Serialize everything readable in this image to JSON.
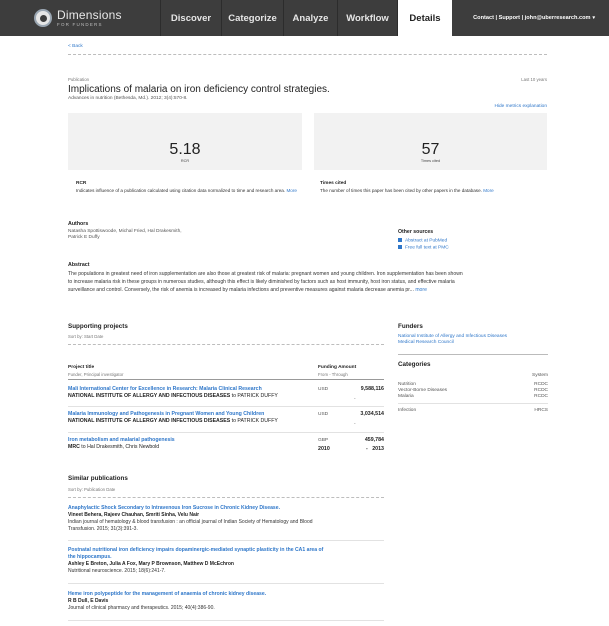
{
  "header": {
    "logo_title": "Dimensions",
    "logo_sub": "FOR FUNDERS",
    "nav": [
      "Discover",
      "Categorize",
      "Analyze",
      "Workflow",
      "Details"
    ],
    "right": "Contact | Support | john@uberresearch.com"
  },
  "back_label": "< Back",
  "publication": {
    "type_label": "Publication",
    "time_range": "Last 10 years",
    "title": "Implications of malaria on iron deficiency control strategies.",
    "citation": "Advances in nutrition (Bethesda, Md.). 2012; 3(4):570-8.",
    "hide_metrics": "Hide metrics explanation"
  },
  "metrics": {
    "rcr_value": "5.18",
    "rcr_label": "RCR",
    "rcr_title": "RCR",
    "rcr_desc": "Indicates influence of a publication calculated using citation data normalized to time and research area.",
    "rcr_more": "More",
    "cited_value": "57",
    "cited_label": "Times cited",
    "cited_title": "Times cited",
    "cited_desc": "The number of times this paper has been cited by other papers in the database.",
    "cited_more": "More"
  },
  "authors": {
    "heading": "Authors",
    "line1": "Natasha Spottiswoode, Michal Fried, Hal Drakesmith,",
    "line2": "Patrick E Duffy"
  },
  "other_sources": {
    "heading": "Other sources",
    "items": [
      "Abstract at PubMed",
      "Free full text at PMC"
    ]
  },
  "abstract": {
    "heading": "Abstract",
    "line1": "The populations in greatest need of iron supplementation are also those at greatest risk of malaria: pregnant women and young children. Iron supplementation has been shown",
    "line2": "to increase malaria risk in these groups in numerous studies, although this effect is likely diminished by factors such as host immunity, host iron status, and effective malaria",
    "line3": "surveillance and control. Conversely, the risk of anemia is increased by malaria infections and preventive measures against malaria decrease anemia pr...",
    "more": "more"
  },
  "supporting_projects": {
    "heading": "Supporting projects",
    "sort": "Sort by: Start Date",
    "col_title": "Project title",
    "col_title_sub": "Funder, Principal investigator",
    "col_funding": "Funding Amount",
    "col_funding_sub": "From - Through",
    "projects": [
      {
        "title": "Mali International Center for Excellence in Research: Malaria Clinical Research",
        "funder": "NATIONAL INSTITUTE OF ALLERGY AND INFECTIOUS DISEASES",
        "to": "to",
        "pi": "PATRICK DUFFY",
        "currency": "USD",
        "amount": "9,588,116",
        "from": "",
        "through": "-"
      },
      {
        "title": "Malaria Immunology and Pathogenesis in Pregnant Women and Young Children",
        "funder": "NATIONAL INSTITUTE OF ALLERGY AND INFECTIOUS DISEASES",
        "to": "to",
        "pi": "PATRICK DUFFY",
        "currency": "USD",
        "amount": "3,034,514",
        "from": "",
        "through": "-"
      },
      {
        "title": "Iron metabolism and malarial pathogenesis",
        "funder": "MRC",
        "to": "to",
        "pi": "Hal Drakesmith, Chris Newbold",
        "currency": "GBP",
        "amount": "459,784",
        "from": "2010",
        "through": "-   2013"
      }
    ]
  },
  "funders": {
    "heading": "Funders",
    "items": [
      "National Institute of Allergy and Infectious Diseases",
      "Medical Research Council"
    ]
  },
  "categories": {
    "heading": "Categories",
    "system_label": "System",
    "groups": [
      {
        "names": [
          "Nutrition",
          "Vector-Borne Diseases",
          "Malaria"
        ],
        "systems": [
          "RCDC",
          "RCDC",
          "RCDC"
        ]
      },
      {
        "names": [
          "Infection"
        ],
        "systems": [
          "HRCS"
        ]
      }
    ]
  },
  "similar": {
    "heading": "Similar publications",
    "sort": "Sort by: Publication Date",
    "items": [
      {
        "title": "Anaphylactic Shock Secondary to Intravenous Iron Sucrose in Chronic Kidney Disease.",
        "authors": "Vineet Behera, Rajeev Chauhan, Smriti Sinha, Velu Nair",
        "journal1": "Indian journal of hematology & blood transfusion : an official journal of Indian Society of Hematology and Blood",
        "journal2": "Transfusion. 2015; 31(3):391-3."
      },
      {
        "title1": "Postnatal nutritional iron deficiency impairs dopaminergic-mediated synaptic plasticity in the CA1 area of",
        "title2": "the hippocampus.",
        "authors": "Ashley E Breton, Julia A Fox, Mary P Brownson, Matthew D McEchron",
        "journal1": "Nutritional neuroscience. 2015; 18(6):241-7."
      },
      {
        "title": "Heme iron polypeptide for the management of anaemia of chronic kidney disease.",
        "authors": "R B Dull, E Davis",
        "journal1": "Journal of clinical pharmacy and therapeutics. 2015; 40(4):386-90."
      }
    ]
  }
}
